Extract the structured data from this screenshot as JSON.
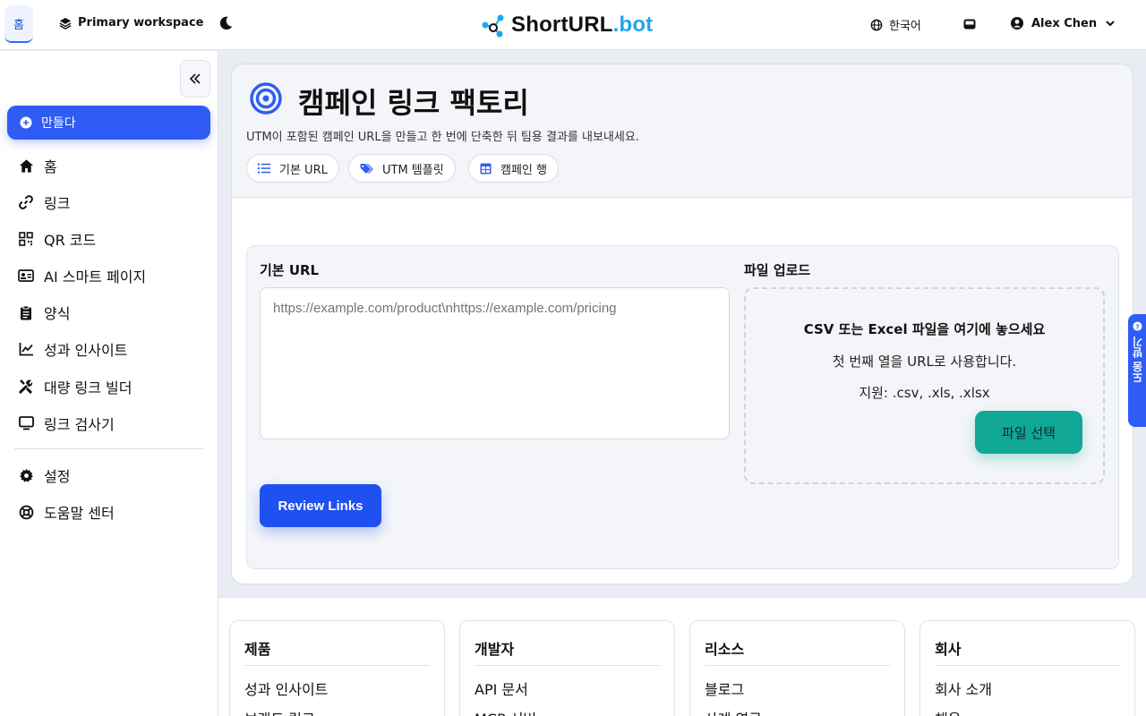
{
  "topbar": {
    "home_tab": "홈",
    "workspace": "Primary workspace",
    "logo_main": "ShortURL",
    "logo_suffix": ".bot",
    "language": "한국어",
    "user_name": "Alex Chen"
  },
  "sidebar": {
    "create_label": "만들다",
    "items": [
      {
        "label": "홈",
        "icon": "home-icon"
      },
      {
        "label": "링크",
        "icon": "link-icon"
      },
      {
        "label": "QR 코드",
        "icon": "qr-icon"
      },
      {
        "label": "AI 스마트 페이지",
        "icon": "id-card-icon"
      },
      {
        "label": "양식",
        "icon": "clipboard-icon"
      },
      {
        "label": "성과 인사이트",
        "icon": "chart-line-icon"
      },
      {
        "label": "대량 링크 빌더",
        "icon": "tools-icon"
      },
      {
        "label": "링크 검사기",
        "icon": "monitor-icon"
      }
    ],
    "bottom_items": [
      {
        "label": "설정",
        "icon": "gear-icon"
      },
      {
        "label": "도움말 센터",
        "icon": "lifebuoy-icon"
      }
    ]
  },
  "main": {
    "title": "캠페인 링크 팩토리",
    "subtitle": "UTM이 포함된 캠페인 URL을 만들고 한 번에 단축한 뒤 팀용 결과를 내보내세요.",
    "pills": [
      {
        "label": "기본 URL",
        "icon": "list-icon"
      },
      {
        "label": "UTM 템플릿",
        "icon": "tags-icon"
      },
      {
        "label": "캠페인 행",
        "icon": "table-icon"
      }
    ],
    "base_url_label": "기본 URL",
    "base_url_placeholder": "https://example.com/product\\nhttps://example.com/pricing",
    "review_button": "Review Links",
    "upload_label": "파일 업로드",
    "dropzone_title": "CSV 또는 Excel 파일을 여기에 놓으세요",
    "dropzone_line1": "첫 번째 열을 URL로 사용합니다.",
    "dropzone_line2": "지원: .csv, .xls, .xlsx",
    "choose_file_button": "파일 선택"
  },
  "footer": {
    "columns": [
      {
        "title": "제품",
        "links": [
          "성과 인사이트",
          "브랜드 링크"
        ]
      },
      {
        "title": "개발자",
        "links": [
          "API 문서",
          "MCP 서버"
        ]
      },
      {
        "title": "리소스",
        "links": [
          "블로그",
          "사례 연구"
        ]
      },
      {
        "title": "회사",
        "links": [
          "회사 소개",
          "채용"
        ]
      }
    ]
  },
  "feedback_tab": "도움 받기",
  "colors": {
    "primary": "#2f5cf5",
    "teal": "#10a895",
    "logo_accent": "#1fa6e8"
  }
}
